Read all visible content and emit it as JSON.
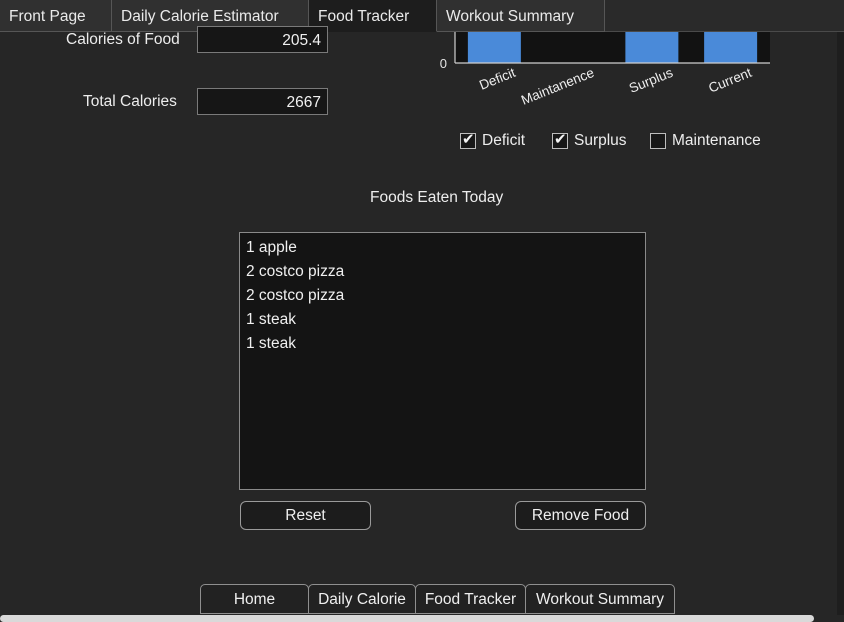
{
  "tabs": [
    "Front Page",
    "Daily Calorie Estimator",
    "Food Tracker",
    "Workout Summary"
  ],
  "form": {
    "calories_of_food_label": "Calories of Food",
    "calories_of_food_value": "205.4",
    "total_calories_label": "Total Calories",
    "total_calories_value": "2667"
  },
  "chart_data": {
    "type": "bar",
    "categories": [
      "Deficit",
      "Maintanence",
      "Surplus",
      "Current"
    ],
    "y_tick_visible": "0",
    "visible_bars": [
      "Deficit",
      "Surplus",
      "Current"
    ],
    "bar_color": "#4a8ad9"
  },
  "checkboxes": [
    {
      "label": "Deficit",
      "checked": true
    },
    {
      "label": "Surplus",
      "checked": true
    },
    {
      "label": "Maintenance",
      "checked": false
    }
  ],
  "foods": {
    "title": "Foods Eaten Today",
    "items": [
      "1 apple",
      "2 costco pizza",
      "2 costco pizza",
      "1 steak",
      "1 steak"
    ]
  },
  "buttons": {
    "reset": "Reset",
    "remove_food": "Remove Food"
  },
  "bottom_tabs": [
    "Home",
    "Daily Calorie",
    "Food Tracker",
    "Workout Summary"
  ]
}
